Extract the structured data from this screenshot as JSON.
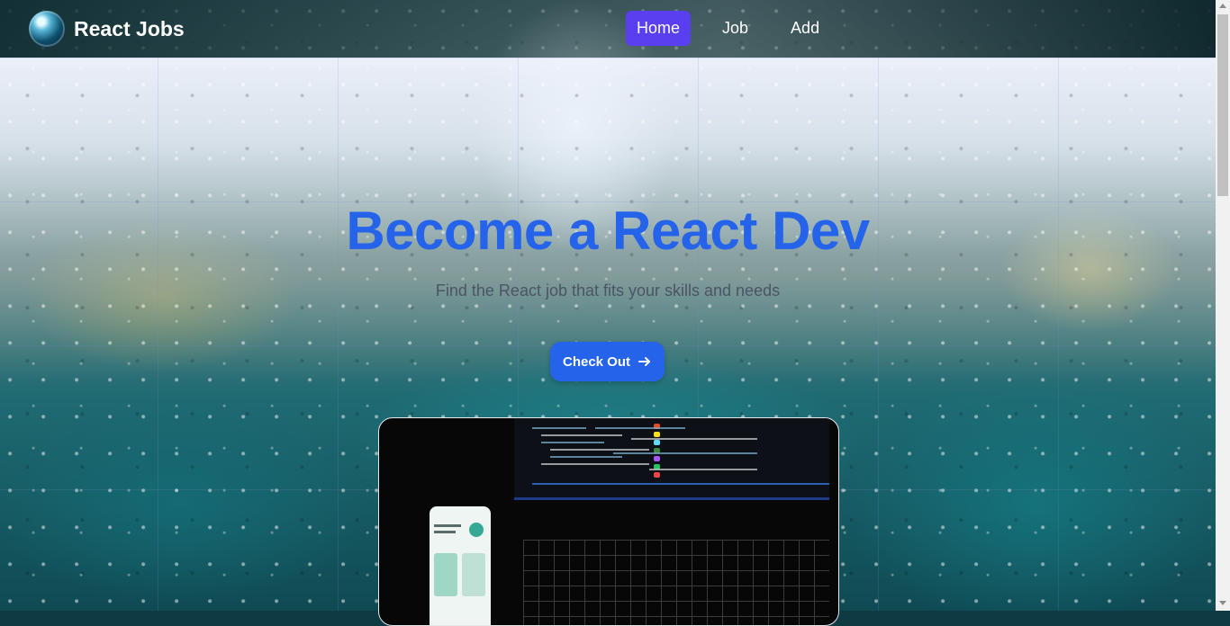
{
  "nav": {
    "brand": "React Jobs",
    "links": [
      {
        "label": "Home",
        "active": true
      },
      {
        "label": "Job",
        "active": false
      },
      {
        "label": "Add",
        "active": false
      }
    ]
  },
  "hero": {
    "title": "Become a React Dev",
    "subtitle": "Find the React job that fits your skills and needs",
    "cta_label": "Check Out",
    "cta_icon": "arrow-right-icon"
  },
  "colors": {
    "accent": "#2563eb",
    "nav_active": "#5a3ff0",
    "subtitle": "#4b5563"
  }
}
